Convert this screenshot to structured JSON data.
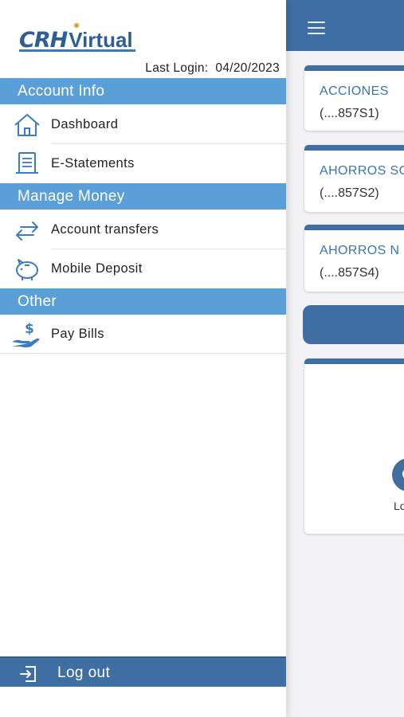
{
  "app": {
    "logo_text_a": "CRH",
    "logo_text_b": "Virtual"
  },
  "last_login": {
    "label": "Last Login:",
    "date": "04/20/2023"
  },
  "drawer": {
    "sections": [
      {
        "title": "Account Info",
        "items": [
          {
            "label": "Dashboard",
            "icon": "home-icon"
          },
          {
            "label": "E-Statements",
            "icon": "document-icon"
          }
        ]
      },
      {
        "title": "Manage Money",
        "items": [
          {
            "label": "Account transfers",
            "icon": "transfer-arrows-icon"
          },
          {
            "label": "Mobile Deposit",
            "icon": "piggy-bank-icon"
          }
        ]
      },
      {
        "title": "Other",
        "items": [
          {
            "label": "Pay Bills",
            "icon": "hand-dollar-icon"
          }
        ]
      }
    ],
    "logout_label": "Log out"
  },
  "main": {
    "accounts": [
      {
        "name": "ACCIONES",
        "number": "(....857S1)"
      },
      {
        "name": "AHORROS SO",
        "number": "(....857S2)"
      },
      {
        "name": "AHORROS N",
        "number": "(....857S4)"
      }
    ],
    "panel_text": "Lo"
  },
  "colors": {
    "primary": "#3f6ea3",
    "section": "#5a9fd8",
    "link": "#3b75ad"
  }
}
